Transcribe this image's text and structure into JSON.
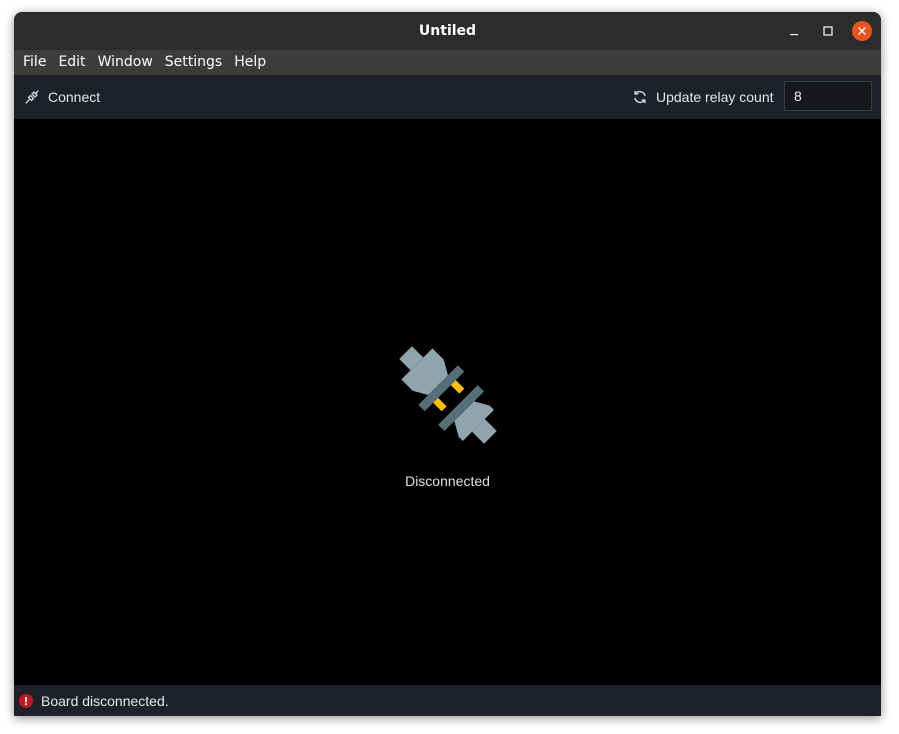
{
  "window": {
    "title": "Untiled",
    "controls": [
      "minimize-icon",
      "maximize-icon",
      "close-icon"
    ]
  },
  "menubar": {
    "items": [
      "File",
      "Edit",
      "Window",
      "Settings",
      "Help"
    ]
  },
  "toolbar": {
    "connect_label": "Connect",
    "connect_icon": "plug-icon",
    "update_label": "Update relay count",
    "update_icon": "refresh-icon",
    "relay_count_value": "8"
  },
  "main": {
    "state_icon": "disconnected-plug-icon",
    "state_text": "Disconnected"
  },
  "statusbar": {
    "icon": "error-icon",
    "message": "Board disconnected."
  },
  "colors": {
    "close_button": "#e95420",
    "error": "#c0181f",
    "plug_body": "#90a4ae",
    "plug_ring": "#546e7a",
    "plug_pins": "#ffc107"
  }
}
